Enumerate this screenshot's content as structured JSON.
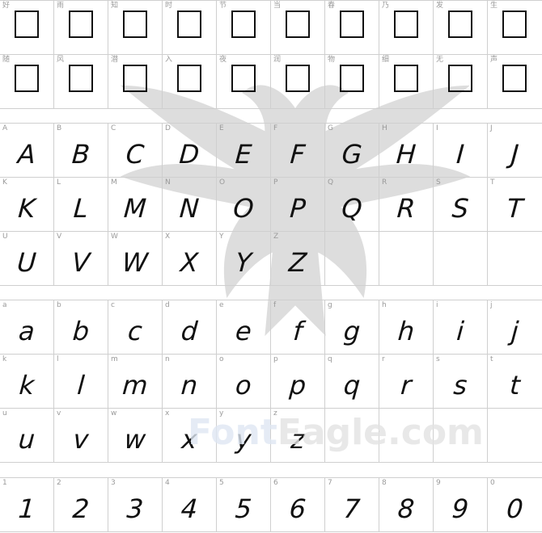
{
  "preview": {
    "cjk_rows": [
      [
        "好",
        "雨",
        "知",
        "时",
        "节",
        "当",
        "春",
        "乃",
        "发",
        "生"
      ],
      [
        "随",
        "风",
        "潜",
        "入",
        "夜",
        "润",
        "物",
        "细",
        "无",
        "声"
      ]
    ],
    "uppercase": [
      "A",
      "B",
      "C",
      "D",
      "E",
      "F",
      "G",
      "H",
      "I",
      "J",
      "K",
      "L",
      "M",
      "N",
      "O",
      "P",
      "Q",
      "R",
      "S",
      "T",
      "U",
      "V",
      "W",
      "X",
      "Y",
      "Z"
    ],
    "lowercase": [
      "a",
      "b",
      "c",
      "d",
      "e",
      "f",
      "g",
      "h",
      "i",
      "j",
      "k",
      "l",
      "m",
      "n",
      "o",
      "p",
      "q",
      "r",
      "s",
      "t",
      "u",
      "v",
      "w",
      "x",
      "y",
      "z"
    ],
    "digits": [
      "1",
      "2",
      "3",
      "4",
      "5",
      "6",
      "7",
      "8",
      "9",
      "0"
    ]
  },
  "watermark": {
    "part1": "Font",
    "part2": "Eagle.com"
  },
  "colors": {
    "grid_line": "#cfcfcf",
    "label": "#9a9a9a",
    "glyph": "#111111",
    "watermark_blue": "#dfe7f3"
  },
  "icons": {
    "background": "eagle-silhouette"
  }
}
